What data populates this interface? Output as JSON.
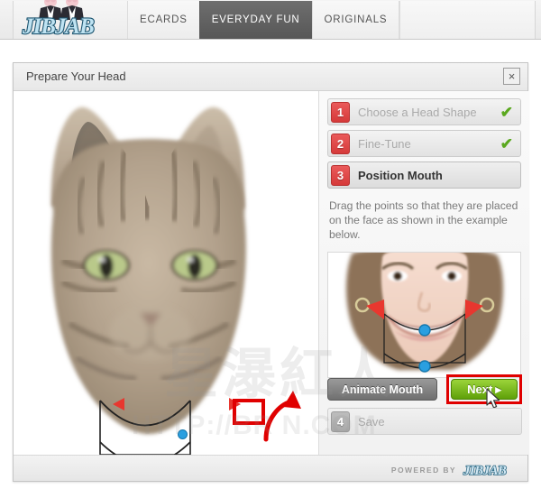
{
  "nav": {
    "logo_text": "JIBJAB",
    "tabs": [
      {
        "label": "ECARDS",
        "active": false
      },
      {
        "label": "EVERYDAY FUN",
        "active": true
      },
      {
        "label": "ORIGINALS",
        "active": false
      }
    ]
  },
  "panel": {
    "title": "Prepare Your Head",
    "close_icon": "×"
  },
  "steps": [
    {
      "number": "1",
      "label": "Choose a Head Shape",
      "state": "complete",
      "check": "✔"
    },
    {
      "number": "2",
      "label": "Fine-Tune",
      "state": "complete",
      "check": "✔"
    },
    {
      "number": "3",
      "label": "Position Mouth",
      "state": "active",
      "check": ""
    },
    {
      "number": "4",
      "label": "Save",
      "state": "disabled",
      "check": ""
    }
  ],
  "instructions": "Drag the points so that they are placed on the face as shown in the example below.",
  "buttons": {
    "animate_label": "Animate Mouth",
    "next_label": "Next",
    "next_arrow": "▸"
  },
  "footer": {
    "powered_by": "POWERED BY",
    "logo_text": "JIBJAB"
  },
  "watermark": {
    "cjk": "星瀑紅人",
    "url": "HTTP://BR   N.COM"
  },
  "colors": {
    "accent_red": "#d63a3a",
    "highlight_red": "#e00000",
    "marker_red": "#e8372f",
    "marker_blue": "#2a9fe0",
    "check_green": "#5aa81e",
    "next_green": "#5fa009",
    "active_tab": "#575757"
  }
}
